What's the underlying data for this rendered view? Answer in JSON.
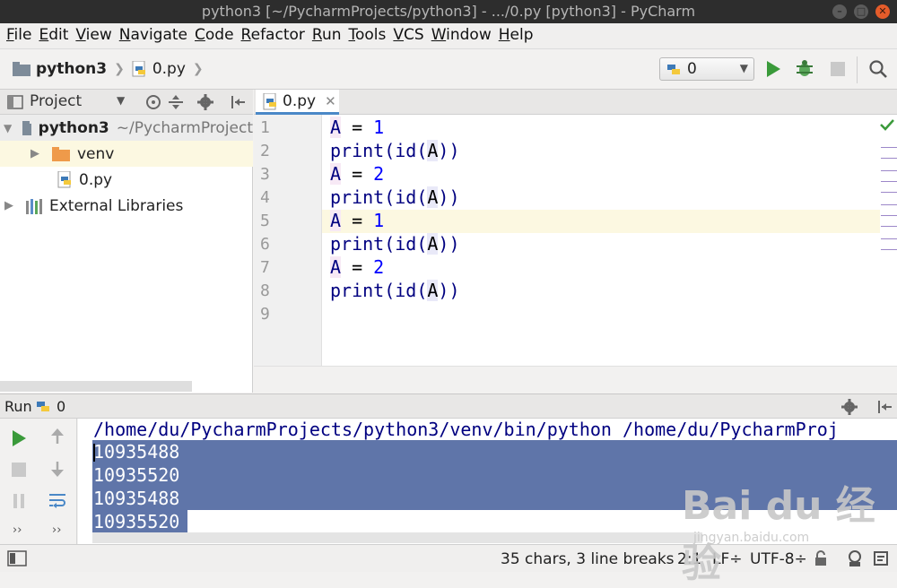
{
  "window": {
    "title": "python3 [~/PycharmProjects/python3] - .../0.py [python3] - PyCharm"
  },
  "menu": [
    {
      "label": "File",
      "u": "F",
      "rest": "ile"
    },
    {
      "label": "Edit",
      "u": "E",
      "rest": "dit"
    },
    {
      "label": "View",
      "u": "V",
      "rest": "iew"
    },
    {
      "label": "Navigate",
      "u": "N",
      "rest": "avigate"
    },
    {
      "label": "Code",
      "u": "C",
      "rest": "ode"
    },
    {
      "label": "Refactor",
      "u": "R",
      "rest": "efactor"
    },
    {
      "label": "Run",
      "u": "R",
      "rest": "un"
    },
    {
      "label": "Tools",
      "u": "T",
      "rest": "ools"
    },
    {
      "label": "VCS",
      "u": "V",
      "rest": "CS"
    },
    {
      "label": "Window",
      "u": "W",
      "rest": "indow"
    },
    {
      "label": "Help",
      "u": "H",
      "rest": "elp"
    }
  ],
  "breadcrumb": {
    "project": "python3",
    "file": "0.py"
  },
  "toolbar": {
    "run_config": "0"
  },
  "project_panel": {
    "title": "Project",
    "root": "python3",
    "root_path": "~/PycharmProject",
    "items": [
      {
        "label": "venv"
      },
      {
        "label": "0.py"
      },
      {
        "label": "External Libraries"
      }
    ]
  },
  "editor": {
    "tab": "0.py",
    "lines": [
      {
        "n": "1",
        "var": "A",
        "op": " = ",
        "val": "1"
      },
      {
        "n": "2",
        "fn": "print(id(",
        "arg": "A",
        "end": "))"
      },
      {
        "n": "3",
        "var": "A",
        "op": " = ",
        "val": "2"
      },
      {
        "n": "4",
        "fn": "print(id(",
        "arg": "A",
        "end": "))"
      },
      {
        "n": "5",
        "var": "A",
        "op": " = ",
        "val": "1"
      },
      {
        "n": "6",
        "fn": "print(id(",
        "arg": "A",
        "end": "))"
      },
      {
        "n": "7",
        "var": "A",
        "op": " = ",
        "val": "2"
      },
      {
        "n": "8",
        "fn": "print(id(",
        "arg": "A",
        "end": "))"
      },
      {
        "n": "9"
      }
    ]
  },
  "run_panel": {
    "label": "Run",
    "config": "0",
    "command": "/home/du/PycharmProjects/python3/venv/bin/python /home/du/PycharmProj",
    "output": [
      "10935488",
      "10935520",
      "10935488",
      "10935520"
    ]
  },
  "status": {
    "selection": "35 chars, 3 line breaks",
    "position": "2:1",
    "line_sep": "LF÷",
    "encoding": "UTF-8÷"
  },
  "watermark": {
    "brand": "Bai du 经验",
    "url": "jingyan.baidu.com"
  },
  "colors": {
    "accent": "#4a88c7",
    "run_green": "#3a9a3a",
    "selection": "#5f75a9",
    "current_line": "#fcf8e1"
  }
}
